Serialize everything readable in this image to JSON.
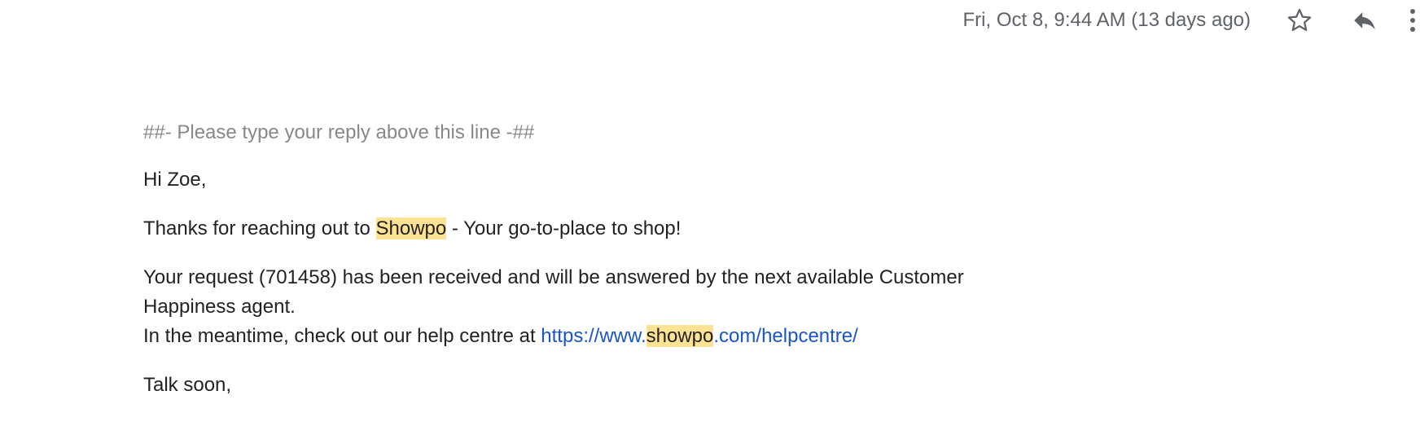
{
  "header": {
    "timestamp": "Fri, Oct 8, 9:44 AM (13 days ago)",
    "icons": [
      "star-icon",
      "reply-icon",
      "more-vert-icon"
    ]
  },
  "message": {
    "reply_marker": "##- Please type your reply above this line -##",
    "greeting": "Hi Zoe,",
    "thanks_prefix": "Thanks for reaching out to ",
    "thanks_highlight": "Showpo",
    "thanks_suffix": " - Your go-to-place to shop!",
    "request_line": "Your request (701458) has been received and will be answered by the next available Customer Happiness agent.",
    "help_prefix": "In the meantime, check out our help centre at ",
    "link_part1": "https://www.",
    "link_highlight": "showpo",
    "link_part2": ".com/helpcentre/",
    "signoff": "Talk soon,"
  },
  "colors": {
    "highlight": "#fde293",
    "link": "#1a55c8",
    "muted": "#888888",
    "text": "#222222"
  }
}
